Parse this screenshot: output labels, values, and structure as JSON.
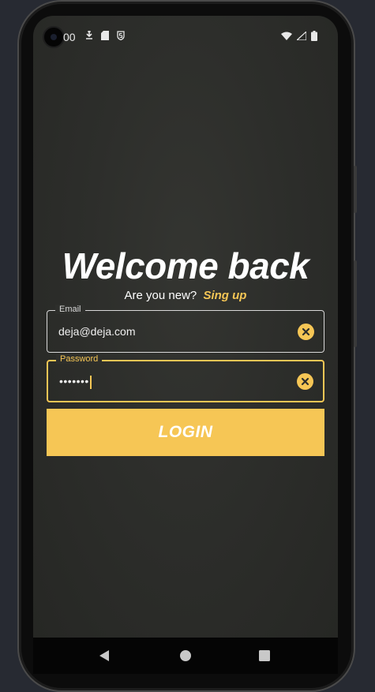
{
  "status_bar": {
    "time": "00",
    "left_icons": [
      "download-arrow-icon",
      "sd-card-icon",
      "shield-s-icon"
    ],
    "right_icons": [
      "wifi-icon",
      "signal-icon",
      "battery-icon"
    ]
  },
  "login": {
    "title": "Welcome back",
    "subtitle": "Are you new?",
    "signup_link": "Sing up",
    "email": {
      "label": "Email",
      "value": "deja@deja.com"
    },
    "password": {
      "label": "Password",
      "value": "•••••••"
    },
    "login_button": "LOGIN"
  },
  "navigation": {
    "items": [
      "back-icon",
      "home-icon",
      "recents-icon"
    ]
  },
  "colors": {
    "accent": "#f6c655",
    "background": "#2e2f2c",
    "text": "#ffffff"
  }
}
